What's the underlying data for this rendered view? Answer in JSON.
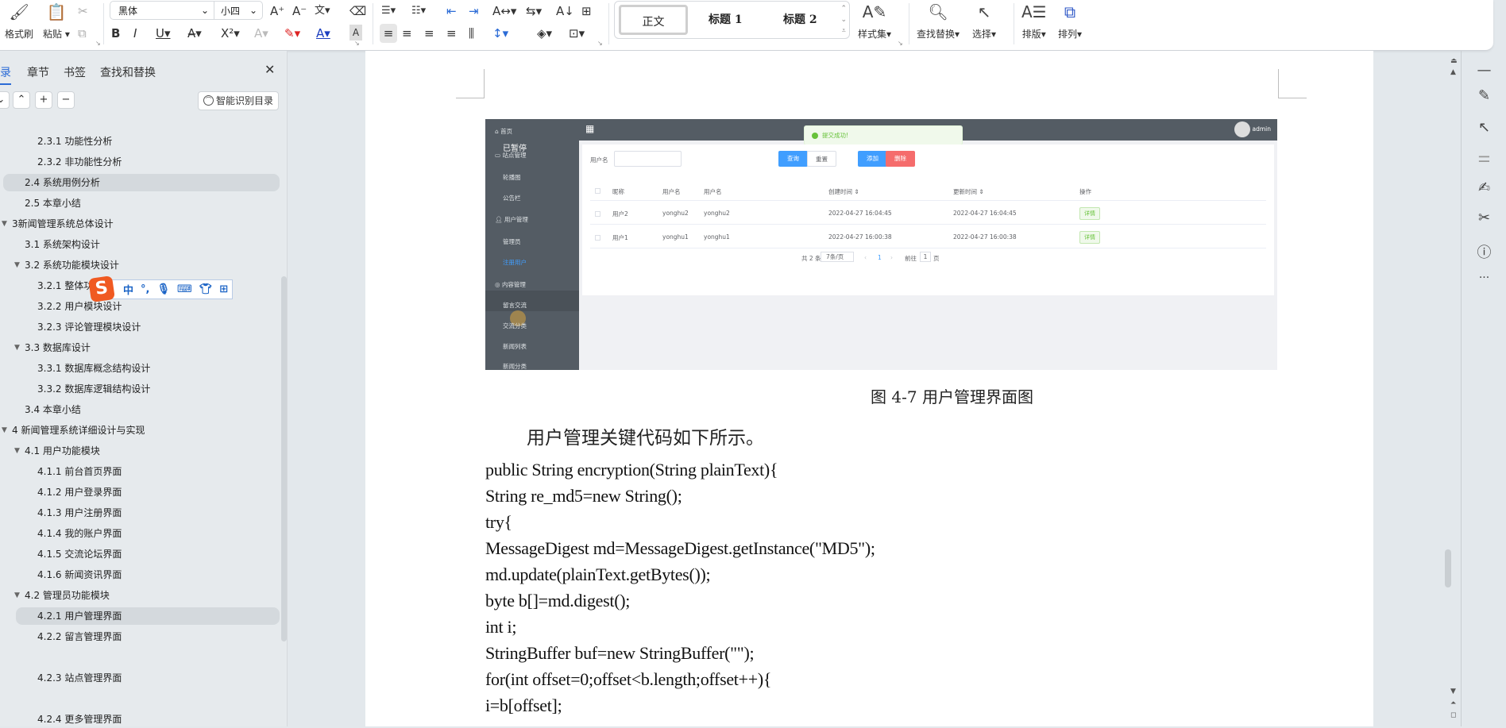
{
  "ribbon": {
    "format_painter": "格式刷",
    "paste": "粘贴",
    "font_name": "黑体",
    "font_size": "小四",
    "styles": {
      "normal": "正文",
      "heading1": "标题 1",
      "heading2": "标题 2"
    },
    "style_set": "样式集",
    "find_replace": "查找替换",
    "select": "选择",
    "layout": "排版",
    "arrange": "排列"
  },
  "panel": {
    "tabs": [
      "目录",
      "章节",
      "书签",
      "查找和替换"
    ],
    "smart_toc_button": "智能识别目录",
    "toc_items": [
      {
        "label": "2.3.1 功能性分析",
        "level": 3,
        "selected": false,
        "expanded": null
      },
      {
        "label": "2.3.2 非功能性分析",
        "level": 3,
        "selected": false,
        "expanded": null
      },
      {
        "label": "2.4 系统用例分析",
        "level": 2,
        "selected": true,
        "expanded": null
      },
      {
        "label": "2.5 本章小结",
        "level": 2,
        "selected": false,
        "expanded": null
      },
      {
        "label": "3新闻管理系统总体设计",
        "level": 1,
        "selected": false,
        "expanded": true
      },
      {
        "label": "3.1 系统架构设计",
        "level": 2,
        "selected": false,
        "expanded": null
      },
      {
        "label": "3.2 系统功能模块设计",
        "level": 2,
        "selected": false,
        "expanded": true
      },
      {
        "label": "3.2.1 整体功能",
        "level": 3,
        "selected": false,
        "expanded": null
      },
      {
        "label": "3.2.2 用户模块设计",
        "level": 3,
        "selected": false,
        "expanded": null
      },
      {
        "label": "3.2.3 评论管理模块设计",
        "level": 3,
        "selected": false,
        "expanded": null
      },
      {
        "label": "3.3 数据库设计",
        "level": 2,
        "selected": false,
        "expanded": true
      },
      {
        "label": "3.3.1 数据库概念结构设计",
        "level": 3,
        "selected": false,
        "expanded": null
      },
      {
        "label": "3.3.2 数据库逻辑结构设计",
        "level": 3,
        "selected": false,
        "expanded": null
      },
      {
        "label": "3.4 本章小结",
        "level": 2,
        "selected": false,
        "expanded": null
      },
      {
        "label": "4 新闻管理系统详细设计与实现",
        "level": 1,
        "selected": false,
        "expanded": true
      },
      {
        "label": "4.1 用户功能模块",
        "level": 2,
        "selected": false,
        "expanded": true
      },
      {
        "label": "4.1.1 前台首页界面",
        "level": 3,
        "selected": false,
        "expanded": null
      },
      {
        "label": "4.1.2 用户登录界面",
        "level": 3,
        "selected": false,
        "expanded": null
      },
      {
        "label": "4.1.3 用户注册界面",
        "level": 3,
        "selected": false,
        "expanded": null
      },
      {
        "label": "4.1.4 我的账户界面",
        "level": 3,
        "selected": false,
        "expanded": null
      },
      {
        "label": "4.1.5 交流论坛界面",
        "level": 3,
        "selected": false,
        "expanded": null
      },
      {
        "label": "4.1.6 新闻资讯界面",
        "level": 3,
        "selected": false,
        "expanded": null
      },
      {
        "label": "4.2 管理员功能模块",
        "level": 2,
        "selected": false,
        "expanded": true
      },
      {
        "label": "4.2.1 用户管理界面",
        "level": 3,
        "selected": true,
        "expanded": null
      },
      {
        "label": "4.2.2 留言管理界面",
        "level": 3,
        "selected": false,
        "expanded": null
      },
      {
        "label": "4.2.3 站点管理界面",
        "level": 3,
        "selected": false,
        "expanded": null
      },
      {
        "label": "4.2.4 更多管理界面",
        "level": 3,
        "selected": false,
        "expanded": null
      }
    ]
  },
  "ime": {
    "mode": "中",
    "punct": "°,"
  },
  "embedded_app": {
    "nav": [
      "首页",
      "站点管理",
      "轮播图",
      "公告栏",
      "用户管理",
      "管理员",
      "注册用户",
      "内容管理",
      "留言交流",
      "交流分类",
      "新闻列表",
      "新闻分类"
    ],
    "overlay_text": "已暂停",
    "user": "admin",
    "toast": "提交成功!",
    "search_label": "用户名",
    "buttons": {
      "query": "查询",
      "reset": "重置",
      "add": "添加",
      "delete": "删除"
    },
    "columns": [
      "昵称",
      "用户名",
      "用户名",
      "创建时间 ⇕",
      "更新时间 ⇕",
      "操作"
    ],
    "rows": [
      [
        "用户2",
        "yonghu2",
        "yonghu2",
        "2022-04-27 16:04:45",
        "2022-04-27 16:04:45",
        "详情"
      ],
      [
        "用户1",
        "yonghu1",
        "yonghu1",
        "2022-04-27 16:00:38",
        "2022-04-27 16:00:38",
        "详情"
      ]
    ],
    "pagination": {
      "total": "共 2 条",
      "page_size": "7条/页",
      "current": "1",
      "goto": "前往",
      "goto_value": "1",
      "page_unit": "页"
    }
  },
  "document": {
    "caption": "图 4-7 用户管理界面图",
    "paragraph": "用户管理关键代码如下所示。",
    "code_lines": [
      "public String encryption(String plainText){",
      "String re_md5=new String();",
      "try{",
      "MessageDigest md=MessageDigest.getInstance(\"MD5\");",
      "md.update(plainText.getBytes());",
      "byte b[]=md.digest();",
      "int i;",
      "StringBuffer buf=new StringBuffer(\"\");",
      "for(int offset=0;offset<b.length;offset++){",
      "i=b[offset];"
    ]
  }
}
